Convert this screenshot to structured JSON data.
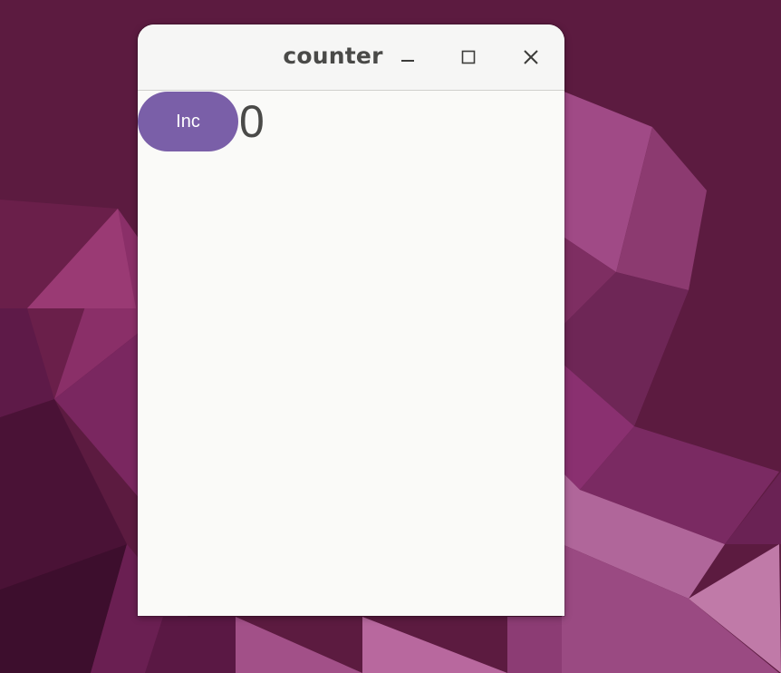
{
  "window": {
    "title": "counter"
  },
  "controls": {
    "minimize_icon": "minimize-icon",
    "maximize_icon": "maximize-icon",
    "close_icon": "close-icon"
  },
  "app": {
    "inc_label": "Inc",
    "counter_value": "0"
  },
  "colors": {
    "accent": "#7a5fa8",
    "desktop": "#5a1a3f",
    "window_bg": "#fafaf8"
  }
}
